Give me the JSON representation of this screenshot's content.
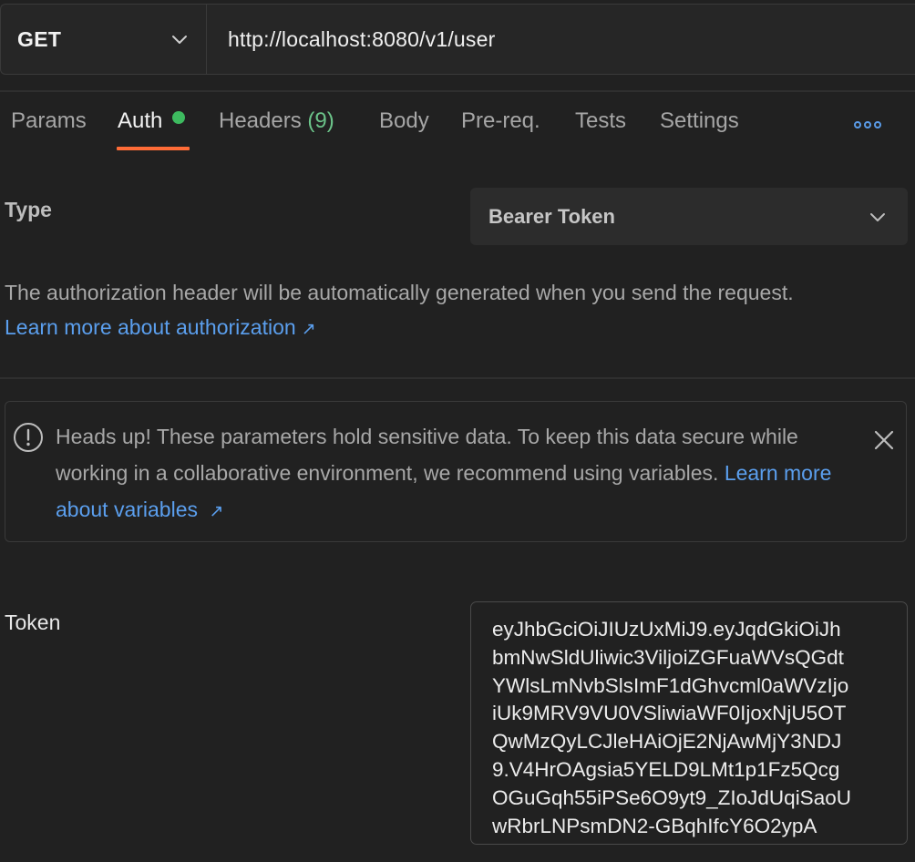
{
  "request": {
    "method": "GET",
    "url": "http://localhost:8080/v1/user"
  },
  "tabs": [
    {
      "label": "Params"
    },
    {
      "label": "Auth",
      "active": true,
      "status": "configured"
    },
    {
      "label": "Headers",
      "count": "(9)"
    },
    {
      "label": "Body"
    },
    {
      "label": "Pre-req."
    },
    {
      "label": "Tests"
    },
    {
      "label": "Settings"
    }
  ],
  "more_icon": "more-horizontal-icon",
  "auth": {
    "type_label": "Type",
    "type_value": "Bearer Token",
    "description": "The authorization header will be automatically generated when you send the request.",
    "learn_more": "Learn more about authorization",
    "arrow": "↗"
  },
  "banner": {
    "text": "Heads up! These parameters hold sensitive data. To keep this data secure while working in a collaborative environment, we recommend using variables.",
    "link": "Learn more about variables",
    "arrow": "↗"
  },
  "token": {
    "label": "Token",
    "lines": [
      "eyJhbGciOiJIUzUxMiJ9.eyJqdGkiOiJh",
      "bmNwSldUliwic3ViljoiZGFuaWVsQGdt",
      "YWlsLmNvbSlsImF1dGhvcml0aWVzIjo",
      "iUk9MRV9VU0VSliwiaWF0IjoxNjU5OT",
      "QwMzQyLCJleHAiOjE2NjAwMjY3NDJ",
      "9.V4HrOAgsia5YELD9LMt1p1Fz5Qcg",
      "OGuGqh55iPSe6O9yt9_ZIoJdUqiSaoU",
      "wRbrLNPsmDN2-GBqhIfcY6O2ypA"
    ]
  },
  "colors": {
    "background": "#212121",
    "accent_tab": "#ff6c37",
    "link": "#5b9fee",
    "status_dot": "#3dba5f"
  }
}
